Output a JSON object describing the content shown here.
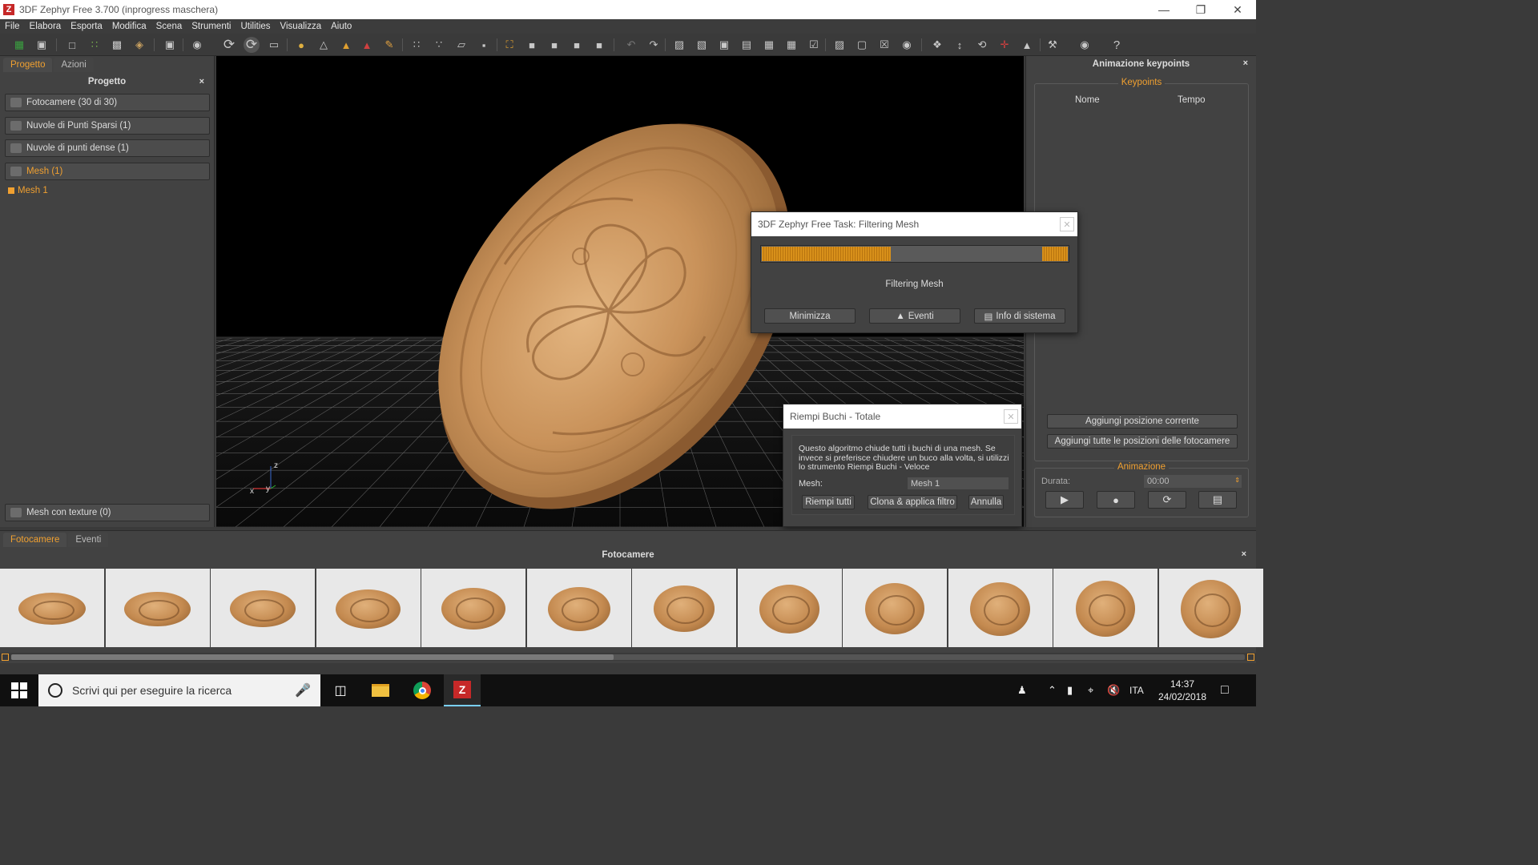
{
  "window": {
    "title": "3DF Zephyr Free 3.700 (inprogress maschera)",
    "logo_letter": "Z"
  },
  "menu": [
    "File",
    "Elabora",
    "Esporta",
    "Modifica",
    "Scena",
    "Strumenti",
    "Utilities",
    "Visualizza",
    "Aiuto"
  ],
  "left_panel": {
    "tabs": [
      "Progetto",
      "Azioni"
    ],
    "title": "Progetto",
    "close": "×",
    "items": [
      {
        "label": "Fotocamere (30 di 30)"
      },
      {
        "label": "Nuvole di Punti Sparsi (1)"
      },
      {
        "label": "Nuvole di punti dense (1)"
      },
      {
        "label": "Mesh (1)"
      }
    ],
    "mesh_child": "Mesh 1",
    "textured": "Mesh con texture (0)"
  },
  "viewport": {
    "axes": {
      "x": "x",
      "y": "y",
      "z": "z"
    }
  },
  "right_panel": {
    "title": "Animazione keypoints",
    "close": "×",
    "keypoints_group": "Keypoints",
    "col_name": "Nome",
    "col_time": "Tempo",
    "btn_add_current": "Aggiungi posizione corrente",
    "btn_add_all": "Aggiungi tutte le posizioni delle fotocamere",
    "anim_group": "Animazione",
    "duration_label": "Durata:",
    "duration_value": "00:00"
  },
  "task_dialog": {
    "title": "3DF Zephyr Free Task: Filtering Mesh",
    "progress": 0.42,
    "status": "Filtering Mesh",
    "btn_minimize": "Minimizza",
    "btn_events": "Eventi",
    "btn_sysinfo": "Info di sistema"
  },
  "holes_dialog": {
    "title": "Riempi Buchi - Totale",
    "description": "Questo algoritmo chiude tutti i buchi di una mesh. Se invece si preferisce chiudere un buco alla volta, si utilizzi lo strumento Riempi Buchi - Veloce",
    "mesh_label": "Mesh:",
    "mesh_value": "Mesh 1",
    "btn_fill_all": "Riempi tutti",
    "btn_clone_apply": "Clona & applica filtro",
    "btn_cancel": "Annulla"
  },
  "bottom_panel": {
    "tabs": [
      "Fotocamere",
      "Eventi"
    ],
    "title": "Fotocamere",
    "close": "×",
    "thumb_count": 12
  },
  "taskbar": {
    "search_placeholder": "Scrivi qui per eseguire la ricerca",
    "language": "ITA",
    "time": "14:37",
    "date": "24/02/2018"
  },
  "colors": {
    "accent": "#f0a030",
    "panel": "#424242",
    "viewport": "#000000"
  }
}
